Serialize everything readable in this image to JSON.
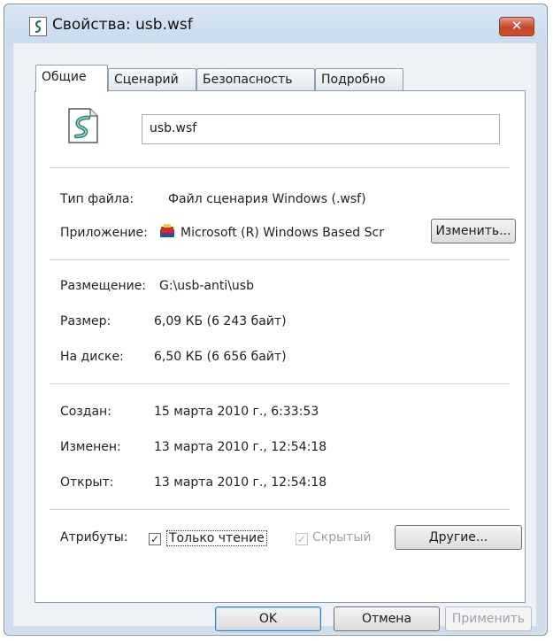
{
  "window": {
    "title": "Свойства: usb.wsf",
    "close_glyph": "✕"
  },
  "tabs": [
    {
      "label": "Общие",
      "active": true
    },
    {
      "label": "Сценарий",
      "active": false
    },
    {
      "label": "Безопасность",
      "active": false
    },
    {
      "label": "Подробно",
      "active": false
    }
  ],
  "general": {
    "file_name": "usb.wsf",
    "type_label": "Тип файла:",
    "type_value": "Файл сценария Windows (.wsf)",
    "app_label": "Приложение:",
    "app_value": "Microsoft (R) Windows Based Scr",
    "change_button": "Изменить...",
    "location_label": "Размещение:",
    "location_value": "G:\\usb-anti\\usb",
    "size_label": "Размер:",
    "size_value": "6,09 КБ (6 243 байт)",
    "disk_label": "На диске:",
    "disk_value": "6,50 КБ (6 656 байт)",
    "created_label": "Создан:",
    "created_value": "15 марта 2010 г., 6:33:53",
    "modified_label": "Изменен:",
    "modified_value": "13 марта 2010 г., 12:54:18",
    "accessed_label": "Открыт:",
    "accessed_value": "13 марта 2010 г., 12:54:18",
    "attributes_label": "Атрибуты:",
    "readonly_label": "Только чтение",
    "readonly_checked": true,
    "hidden_label": "Скрытый",
    "hidden_checked": true,
    "other_button": "Другие..."
  },
  "footer": {
    "ok": "OK",
    "cancel": "Отмена",
    "apply": "Применить"
  }
}
